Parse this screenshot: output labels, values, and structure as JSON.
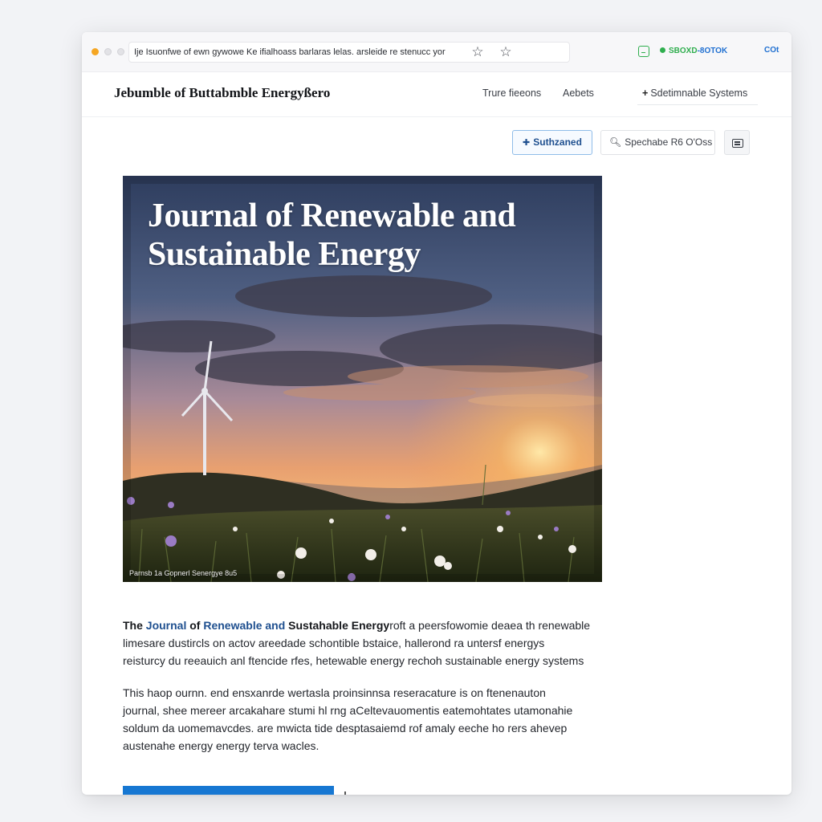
{
  "browser": {
    "url_text": "Ije Isuonfwe of ewn gywowe Ke ifialhoass barlaras lelas. arsleide re stenucc yor",
    "status_pill": "SBOXD",
    "status_pill_suffix": "-8OTOK",
    "right_label": "COt",
    "icons": [
      "star-icon",
      "star-outline-icon",
      "extension-icon"
    ]
  },
  "header": {
    "site_title": "Jebumble of Buttabmble Energyßero",
    "nav": [
      {
        "label": "Trure fieeons"
      },
      {
        "label": "Aebets"
      }
    ],
    "cta_label": "Sdetimnable Systems"
  },
  "actions": {
    "subscribe_label": "Suthzaned",
    "search_placeholder": "Spechabe R6 O'Oss"
  },
  "hero": {
    "title_line1": "Journal of Renewable and",
    "title_line2": "Sustainable Energy",
    "credit": "Parnsb 1a Gopnerl Senergye 8u5"
  },
  "article": {
    "p1_seg1": "The ",
    "p1_seg2": "Journal",
    "p1_seg3": " of ",
    "p1_seg4": "Renewable and",
    "p1_seg5": " Sustahable Energy",
    "p1_seg6": "roft a peersfowomie deaea th renewable",
    "p1_line2": "limesare dustircls on actov areedade schontible bstaice, hallerond ra untersf energys",
    "p1_line3": "reisturcy du reeauich anl ftencide rfes, hetewable energy rechoh sustainable energy systems",
    "p2_line1": "This haop ournn. end ensxanrde wertasla proinsinnsa reseracature is on ftenenauton",
    "p2_line2": "journal, shee mereer arcakahare stumi hl rng aCeltevauomentis eatemohtates utamonahie",
    "p2_line3": "soldum da uomemavcdes. are mwicta tide desptasaiemd rof amaly eeche ho rers ahevep",
    "p2_line4": "austenahe energy energy terva wacles."
  },
  "colors": {
    "accent": "#1677d2",
    "link_blue": "#1e4f8f",
    "status_green": "#2fae4e"
  }
}
